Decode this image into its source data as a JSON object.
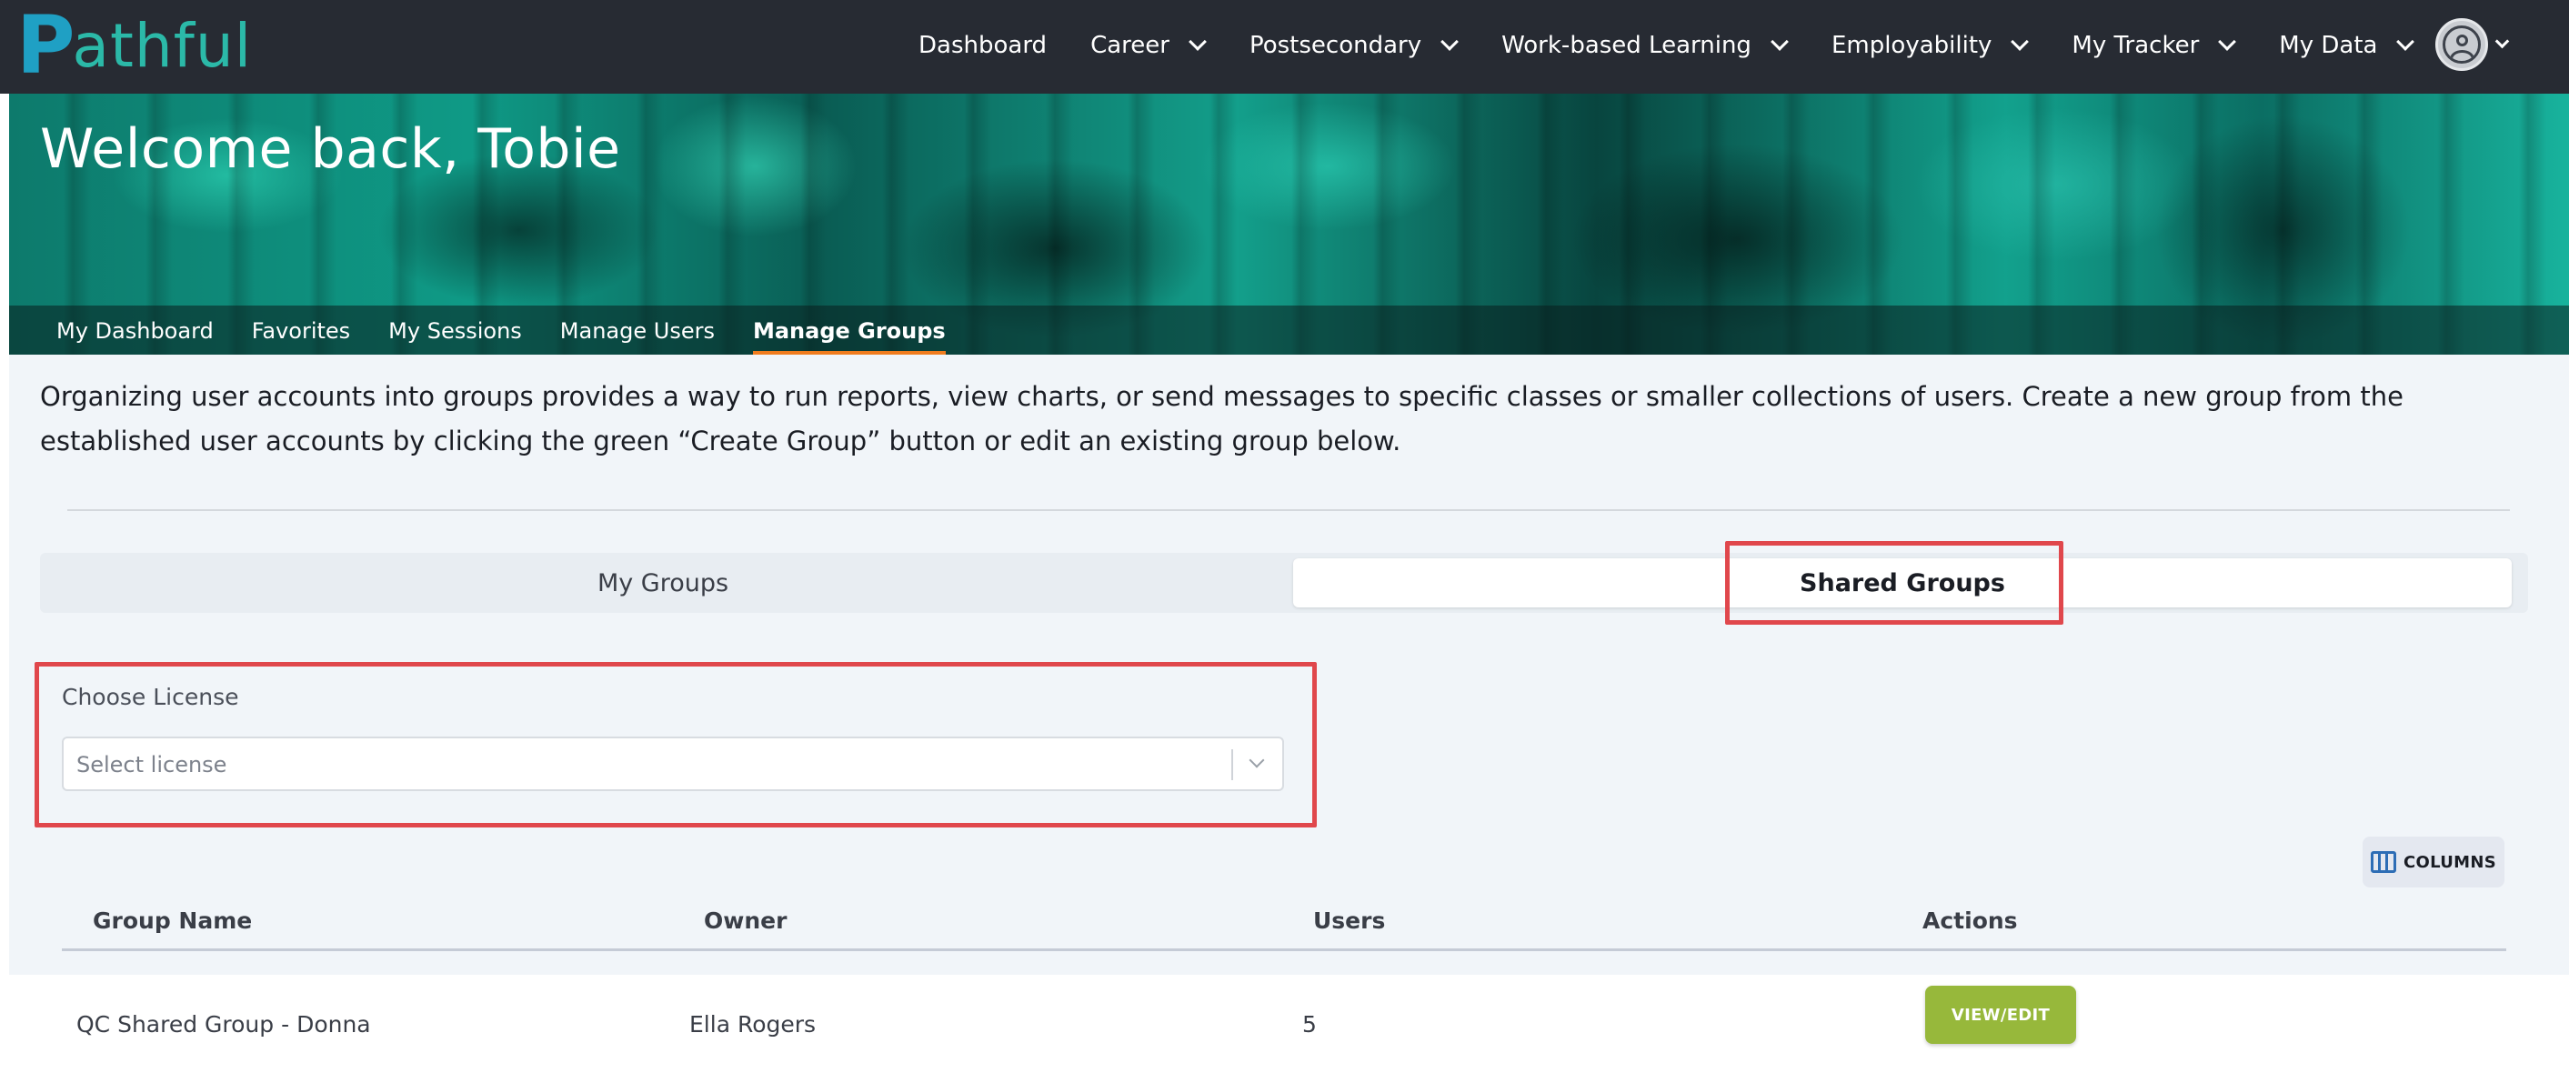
{
  "brand": {
    "logo_text": "athful",
    "logo_initial": "P",
    "name": "Pathful"
  },
  "nav": {
    "items": [
      {
        "label": "Dashboard",
        "dropdown": false
      },
      {
        "label": "Career",
        "dropdown": true
      },
      {
        "label": "Postsecondary",
        "dropdown": true
      },
      {
        "label": "Work-based Learning",
        "dropdown": true
      },
      {
        "label": "Employability",
        "dropdown": true
      },
      {
        "label": "My Tracker",
        "dropdown": true
      },
      {
        "label": "My Data",
        "dropdown": true
      }
    ]
  },
  "hero": {
    "title": "Welcome back, Tobie"
  },
  "subnav": {
    "items": [
      {
        "label": "My Dashboard"
      },
      {
        "label": "Favorites"
      },
      {
        "label": "My Sessions"
      },
      {
        "label": "Manage Users"
      },
      {
        "label": "Manage Groups",
        "active": true
      }
    ]
  },
  "intro_text": "Organizing user accounts into groups provides a way to run reports, view charts, or send messages to specific classes or smaller collections of users. Create a new group from the established user accounts by clicking the green “Create Group” button or edit an existing group below.",
  "tabs": {
    "my_groups": "My Groups",
    "shared_groups": "Shared Groups",
    "active": "Shared Groups"
  },
  "license": {
    "label": "Choose License",
    "placeholder": "Select license"
  },
  "columns_button": {
    "label": "COLUMNS"
  },
  "table": {
    "headers": [
      "Group Name",
      "Owner",
      "Users",
      "Actions"
    ],
    "rows": [
      {
        "group_name": "QC Shared Group - Donna",
        "owner": "Ella Rogers",
        "users": "5",
        "action_label": "VIEW/EDIT"
      }
    ]
  },
  "colors": {
    "nav_bg": "#272b33",
    "accent_orange": "#f07c1e",
    "highlight_red": "#e0474c",
    "button_green": "#97b83b",
    "content_bg": "#f1f5f9"
  }
}
